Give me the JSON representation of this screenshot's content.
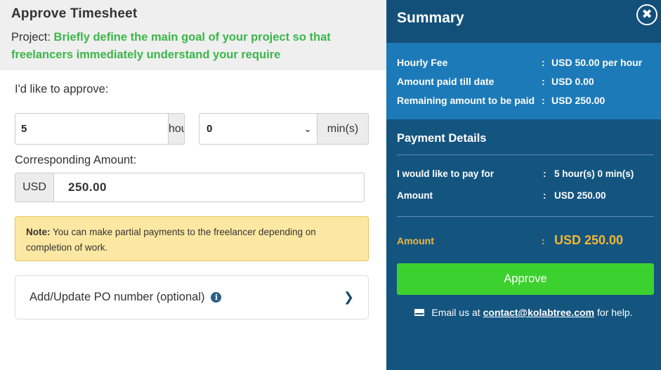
{
  "header": {
    "title": "Approve Timesheet",
    "project_prefix": "Project:",
    "project_goal": "Briefly define the main goal of your project so that freelancers immediately understand your require"
  },
  "form": {
    "approve_label": "I'd like to approve:",
    "hours_value": "5",
    "hours_unit": "hour(s)",
    "minutes_selected": "0",
    "minutes_unit": "min(s)",
    "amount_label": "Corresponding Amount:",
    "currency": "USD",
    "amount_value": "250.00"
  },
  "note": {
    "prefix": "Note:",
    "text": "You can make partial payments to the freelancer depending on completion of work."
  },
  "po": {
    "label": "Add/Update PO number (optional)",
    "info_icon": "info-icon",
    "arrow_icon": "chevron-right-icon"
  },
  "summary": {
    "title": "Summary",
    "close_icon": "close-icon",
    "rows": [
      {
        "label": "Hourly Fee",
        "value": "USD 50.00 per hour"
      },
      {
        "label": "Amount paid till date",
        "value": "USD 0.00"
      },
      {
        "label": "Remaining amount to be paid",
        "value": "USD 250.00"
      }
    ]
  },
  "payment": {
    "title": "Payment Details",
    "rows": [
      {
        "label": "I would like to pay for",
        "value": "5 hour(s) 0 min(s)"
      },
      {
        "label": "Amount",
        "value": "USD 250.00"
      }
    ],
    "total_label": "Amount",
    "total_value": "USD 250.00",
    "approve_label": "Approve",
    "help_prefix": "Email us at",
    "help_email": "contact@kolabtree.com",
    "help_suffix": "for help."
  },
  "colors": {
    "accent_green": "#3cb64a",
    "summary_dark": "#145580",
    "summary_light": "#1d7ab8",
    "total_gold": "#f2b635",
    "approve_green": "#3dd12f"
  }
}
